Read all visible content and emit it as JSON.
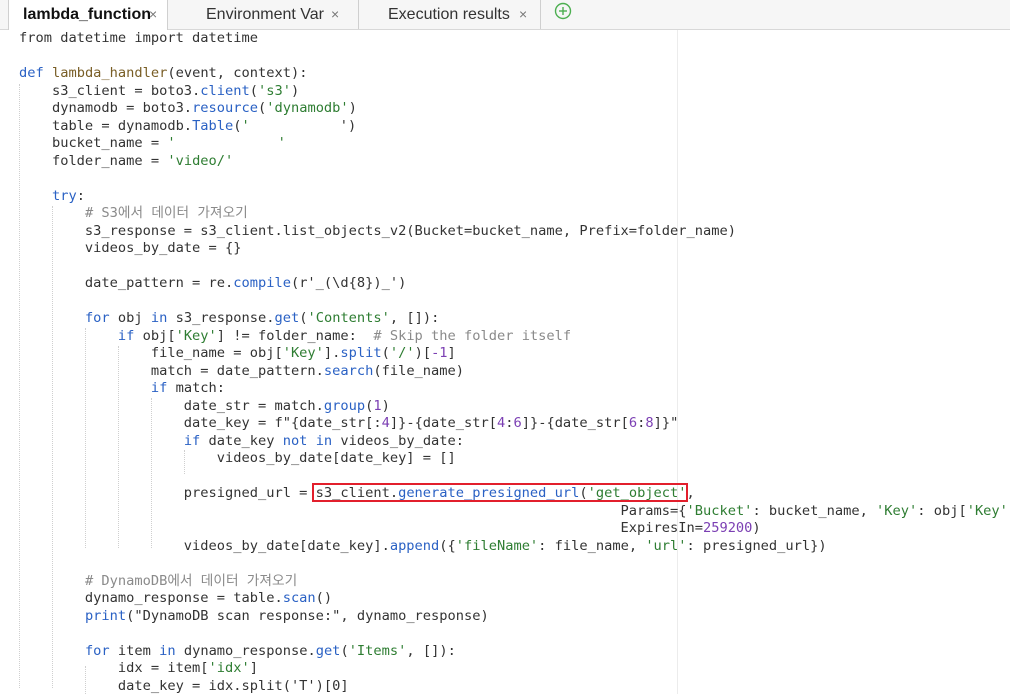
{
  "tabs": [
    {
      "label": "lambda_function",
      "close": "×",
      "active": true
    },
    {
      "label": "Environment Var",
      "close": "×",
      "active": false
    },
    {
      "label": "Execution results",
      "close": "×",
      "active": false
    }
  ],
  "add_tab_icon": "plus-circle-icon",
  "colors": {
    "highlight_box": "#e21f2c",
    "keyword": "#2a61c4",
    "string": "#2e7d32",
    "comment": "#8a8a8a",
    "number": "#7b3fb3"
  },
  "code": {
    "line0": [
      "from datetime import datetime"
    ],
    "line1": [
      "def",
      " ",
      "lambda_handler",
      "(event, context):"
    ],
    "line2": [
      "    s3_client = boto3.",
      "client",
      "(",
      "'s3'",
      ")"
    ],
    "line3": [
      "    dynamodb = boto3.",
      "resource",
      "(",
      "'dynamodb'",
      ")"
    ],
    "line4": [
      "    table = dynamodb.",
      "Table",
      "(",
      "'",
      "')"
    ],
    "line5": [
      "    bucket_name = ",
      "'",
      "'"
    ],
    "line6": [
      "    folder_name = ",
      "'video/'"
    ],
    "line7": [
      "    ",
      "try",
      ":"
    ],
    "line8": [
      "        ",
      "# S3에서 데이터 가져오기"
    ],
    "line9": [
      "        s3_response = s3_client.list_objects_v2(Bucket=bucket_name, Prefix=folder_name)"
    ],
    "line10": [
      "        videos_by_date = {}"
    ],
    "line11": [
      "        date_pattern = re.",
      "compile",
      "(r'_(\\d{8})_')"
    ],
    "line12": [
      "        ",
      "for",
      " obj ",
      "in",
      " s3_response.",
      "get",
      "(",
      "'Contents'",
      ", []):"
    ],
    "line13": [
      "            ",
      "if",
      " obj[",
      "'Key'",
      "] != folder_name:  ",
      "# Skip the folder itself"
    ],
    "line14": [
      "                file_name = obj[",
      "'Key'",
      "].",
      "split",
      "(",
      "'/'",
      ")[",
      "-1",
      "]"
    ],
    "line15": [
      "                match = date_pattern.",
      "search",
      "(file_name)"
    ],
    "line16": [
      "                ",
      "if",
      " match:"
    ],
    "line17": [
      "                    date_str = match.",
      "group",
      "(",
      "1",
      ")"
    ],
    "line18": [
      "                    date_key = f\"{date_str[:",
      "4",
      "]}-{date_str[",
      "4",
      ":",
      "6",
      "]}-{date_str[",
      "6",
      ":",
      "8",
      "]}\""
    ],
    "line19": [
      "                    ",
      "if",
      " date_key ",
      "not",
      " ",
      "in",
      " videos_by_date:"
    ],
    "line20": [
      "                        videos_by_date[date_key] = []"
    ],
    "line21": [
      "                    presigned_url = ",
      "s3_client.",
      "generate_presigned_url",
      "(",
      "'get_object'",
      ","
    ],
    "line22": [
      "                                                                         Params={",
      "'Bucket'",
      ": bucket_name, ",
      "'Key'",
      ": obj[",
      "'Key'",
      "]},"
    ],
    "line23": [
      "                                                                         ExpiresIn=",
      "259200",
      ")"
    ],
    "line24": [
      "                    videos_by_date[date_key].",
      "append",
      "({",
      "'fileName'",
      ": file_name, ",
      "'url'",
      ": presigned_url})"
    ],
    "line25": [
      "        ",
      "# DynamoDB에서 데이터 가져오기"
    ],
    "line26": [
      "        dynamo_response = table.",
      "scan",
      "()"
    ],
    "line27": [
      "        ",
      "print",
      "(\"DynamoDB scan response:\", dynamo_response)"
    ],
    "line28": [
      "        ",
      "for",
      " item ",
      "in",
      " dynamo_response.",
      "get",
      "(",
      "'Items'",
      ", []):"
    ],
    "line29": [
      "            idx = item[",
      "'idx'",
      "]"
    ],
    "line30": [
      "            date_key = idx.split('T')[0]"
    ]
  }
}
